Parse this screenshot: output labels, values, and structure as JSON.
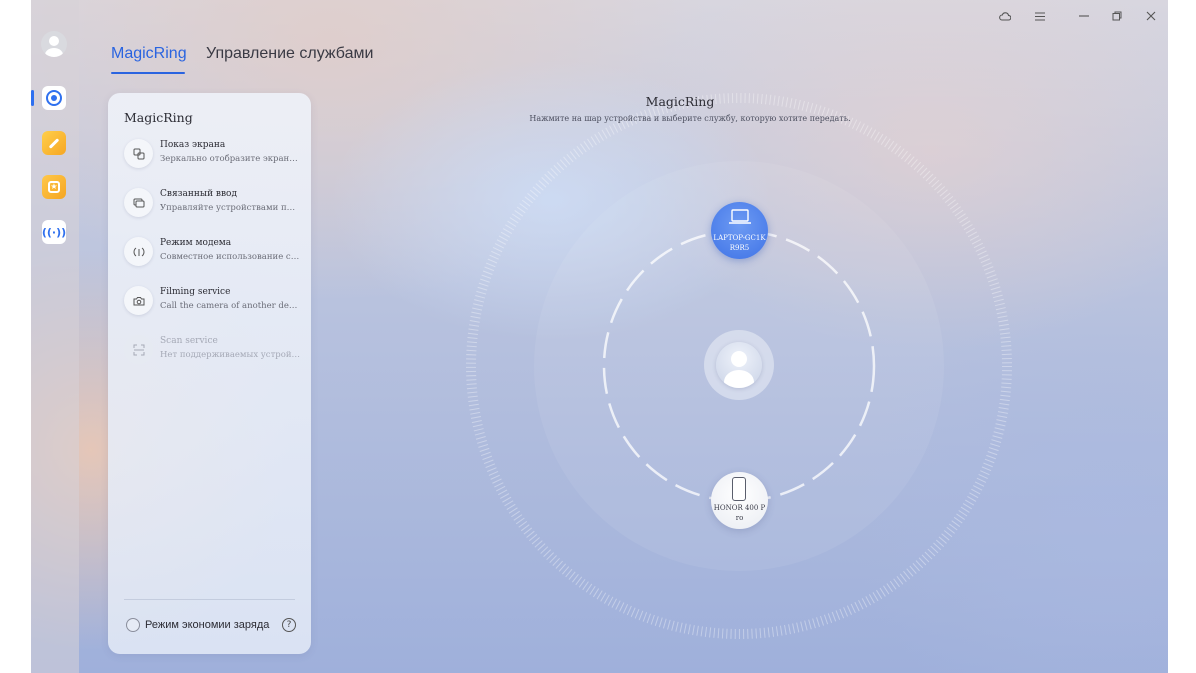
{
  "tabs": {
    "magicring": "MagicRing",
    "service_management": "Управление службами"
  },
  "panel": {
    "title": "MagicRing",
    "services": [
      {
        "name": "Показ экрана",
        "description": "Зеркально отобразите экран этого устройства",
        "icon": "screen-mirror-icon",
        "enabled": true
      },
      {
        "name": "Связанный ввод",
        "description": "Управляйте устройствами поблизости",
        "icon": "linked-input-icon",
        "enabled": true
      },
      {
        "name": "Режим модема",
        "description": "Совместное использование сети мобильного",
        "icon": "modem-icon",
        "enabled": true
      },
      {
        "name": "Filming service",
        "description": "Call the camera of another device to film",
        "icon": "camera-icon",
        "enabled": true
      },
      {
        "name": "Scan service",
        "description": "Нет поддерживаемых устройств.",
        "icon": "scan-icon",
        "enabled": false
      }
    ],
    "power_saving_label": "Режим экономии заряда",
    "help_glyph": "?"
  },
  "main": {
    "title": "MagicRing",
    "subtitle": "Нажмите на шар устройства и выберите службу, которую хотите передать."
  },
  "devices": {
    "laptop": {
      "name": "LAPTOP-GC1KR9R5",
      "icon": "laptop-icon"
    },
    "phone": {
      "name": "HONOR 400 Pro",
      "icon": "phone-icon"
    }
  },
  "colors": {
    "accent": "#2a64e0",
    "laptop_ball": "#3f73e6"
  }
}
